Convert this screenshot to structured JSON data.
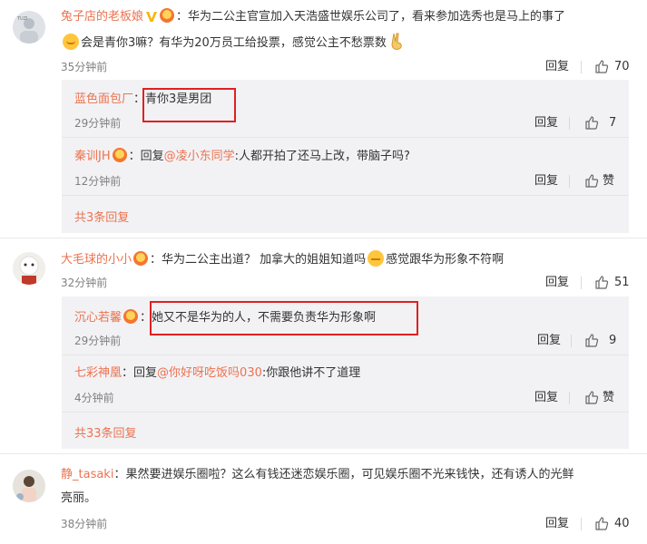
{
  "comments": [
    {
      "user": "兔子店的老板娘",
      "text1": "：华为二公主官宣加入天浩盛世娱乐公司了，看来参加选秀也是马上的事了",
      "text2": "会是青你3嘛？有华为20万员工给投票，感觉公主不愁票数",
      "time": "35分钟前",
      "reply_label": "回复",
      "likes": "70",
      "subs": [
        {
          "user": "蓝色面包厂",
          "sep": "：",
          "text": "青你3是男团",
          "time": "29分钟前",
          "reply_label": "回复",
          "likes": "7"
        },
        {
          "user": "秦训JH",
          "sep": "：",
          "reply_prefix": "回复",
          "mention": "@凌小东同学",
          "text": ":人都开拍了还马上改，带脑子吗?",
          "time": "12分钟前",
          "reply_label": "回复",
          "likes": "赞"
        }
      ],
      "more": "共3条回复"
    },
    {
      "user": "大毛球的小小",
      "text1": "：华为二公主出道？ 加拿大的姐姐知道吗",
      "text1b": "感觉跟华为形象不符啊",
      "time": "32分钟前",
      "reply_label": "回复",
      "likes": "51",
      "subs": [
        {
          "user": "沉心若馨",
          "sep": "：",
          "text": "她又不是华为的人，不需要负责华为形象啊",
          "time": "29分钟前",
          "reply_label": "回复",
          "likes": "9"
        },
        {
          "user": "七彩神凰",
          "sep": "：",
          "reply_prefix": "回复",
          "mention": "@你好呀吃饭吗030",
          "text": ":你跟他讲不了道理",
          "time": "4分钟前",
          "reply_label": "回复",
          "likes": "赞"
        }
      ],
      "more": "共33条回复"
    },
    {
      "user": "静_tasaki",
      "text1": "：果然要进娱乐圈啦？这么有钱还迷恋娱乐圈，可见娱乐圈不光来钱快，还有诱人的光鲜",
      "text2": "亮丽。",
      "time": "38分钟前",
      "reply_label": "回复",
      "likes": "40"
    }
  ],
  "colors": {
    "accent": "#eb7350",
    "highlight": "#e02020",
    "sub_bg": "#f2f2f5"
  },
  "icons": [
    "thumbs-up-icon",
    "vip-v-icon",
    "member-badge-icon",
    "emoji-icon",
    "victory-hand-emoji"
  ]
}
